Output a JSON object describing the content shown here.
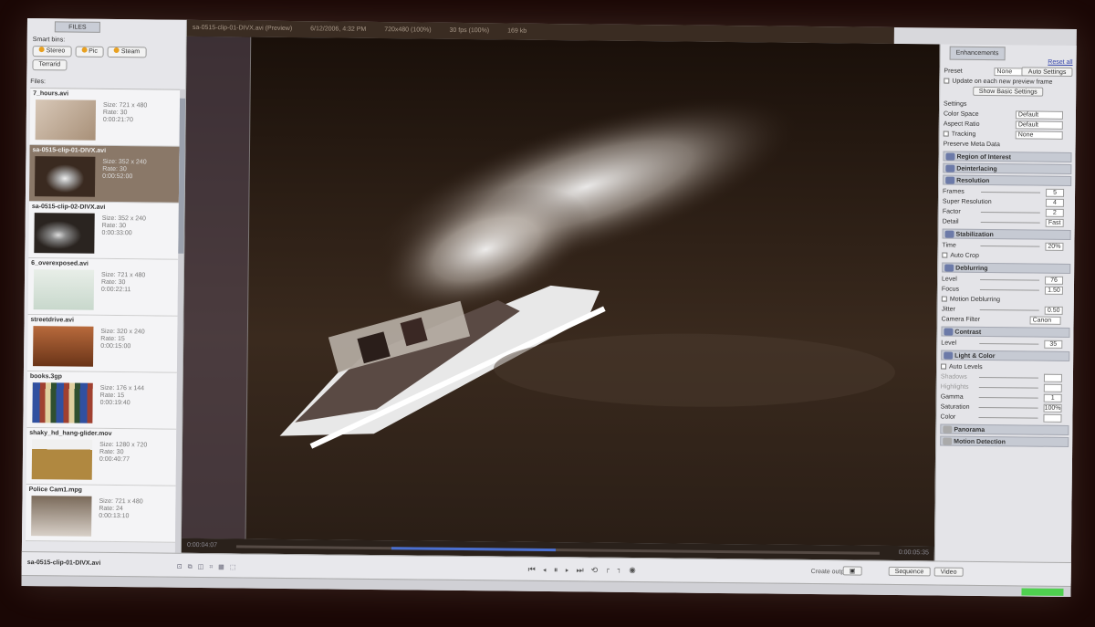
{
  "left_panel": {
    "tab": "FILES",
    "smart_bins_label": "Smart bins:",
    "smart_buttons": [
      "Stereo",
      "Pic",
      "Steam",
      "Terrarid"
    ],
    "files_label": "Files:",
    "files": [
      {
        "name": "7_hours.avi",
        "info": [
          "Size: 721 x 480",
          "Rate: 30",
          "0:00:21:70"
        ]
      },
      {
        "name": "sa-0515-clip-01-DIVX.avi",
        "info": [
          "Size: 352 x 240",
          "Rate: 30",
          "0:00:52:00"
        ]
      },
      {
        "name": "sa-0515-clip-02-DIVX.avi",
        "info": [
          "Size: 352 x 240",
          "Rate: 30",
          "0:00:33:00"
        ]
      },
      {
        "name": "6_overexposed.avi",
        "info": [
          "Size: 721 x 480",
          "Rate: 30",
          "0:00:22:11"
        ]
      },
      {
        "name": "streetdrive.avi",
        "info": [
          "Size: 320 x 240",
          "Rate: 15",
          "0:00:15:00"
        ]
      },
      {
        "name": "books.3gp",
        "info": [
          "Size: 176 x 144",
          "Rate: 15",
          "0:00:19:40"
        ]
      },
      {
        "name": "shaky_hd_hang-glider.mov",
        "info": [
          "Size: 1280 x 720",
          "Rate: 30",
          "0:00:40:77"
        ]
      },
      {
        "name": "Police Cam1.mpg",
        "info": [
          "Size: 721 x 480",
          "Rate: 24",
          "0:00:13:10"
        ]
      }
    ]
  },
  "titlebar": {
    "file": "sa-0515-clip-01-DIVX.avi (Preview)",
    "date": "6/12/2006, 4:32 PM",
    "size": "720x480 (100%)",
    "fps": "30 fps (100%)",
    "bitrate": "169 kb"
  },
  "timeline": {
    "current": "0:00:04:07",
    "total": "0:00:05:35",
    "progress": 0.34
  },
  "right_panel": {
    "tab": "Enhancements",
    "reset_link": "Reset all",
    "preset_label": "Preset",
    "preset_value": "None",
    "auto_settings": "Auto Settings",
    "auto_check_label": "Update on each new preview frame",
    "show_basic": "Show Basic Settings",
    "settings_label": "Settings",
    "color_space_label": "Color Space",
    "color_space_value": "Default",
    "aspect_label": "Aspect Ratio",
    "aspect_value": "Default",
    "tracking_label": "Tracking",
    "tracking_value": "None",
    "preserve_label": "Preserve Meta Data",
    "sections": {
      "region": "Region of Interest",
      "deinterlacing": "Deinterlacing",
      "resolution": "Resolution",
      "stabilization": "Stabilization",
      "deblurring": "Deblurring",
      "contrast": "Contrast",
      "light": "Light & Color",
      "panorama": "Panorama",
      "motion": "Motion Detection"
    },
    "resolution_rows": [
      {
        "label": "Frames",
        "value": "5"
      },
      {
        "label": "Super Resolution",
        "value": "4"
      },
      {
        "label": "Factor",
        "value": "2"
      },
      {
        "label": "Detail",
        "value": "Fast"
      }
    ],
    "stab_rows": [
      {
        "label": "Time",
        "value": "20%"
      }
    ],
    "auto_crop": "Auto Crop",
    "deblur_rows": [
      {
        "label": "Level",
        "value": "76"
      },
      {
        "label": "Focus",
        "value": "1.50"
      },
      {
        "label": "Motion Deblurring",
        "value": ""
      },
      {
        "label": "Jitter",
        "value": "0.50"
      },
      {
        "label": "Camera Filter",
        "value": "Canon"
      }
    ],
    "contrast_rows": [
      {
        "label": "Level",
        "value": "35"
      }
    ],
    "light_rows": [
      {
        "label": "Auto Levels",
        "value": ""
      },
      {
        "label": "Shadows",
        "value": ""
      },
      {
        "label": "Highlights",
        "value": ""
      },
      {
        "label": "Gamma",
        "value": "1"
      },
      {
        "label": "Saturation",
        "value": "100%"
      },
      {
        "label": "Color",
        "value": ""
      }
    ]
  },
  "bottom": {
    "current_file": "sa-0515-clip-01-DIVX.avi",
    "output_label": "Create output:",
    "btn_sequence": "Sequence",
    "btn_video": "Video"
  },
  "colors": {
    "accent": "#4a6fd0",
    "section_on": "#6c7aa8",
    "memory": "#4fd04f"
  }
}
